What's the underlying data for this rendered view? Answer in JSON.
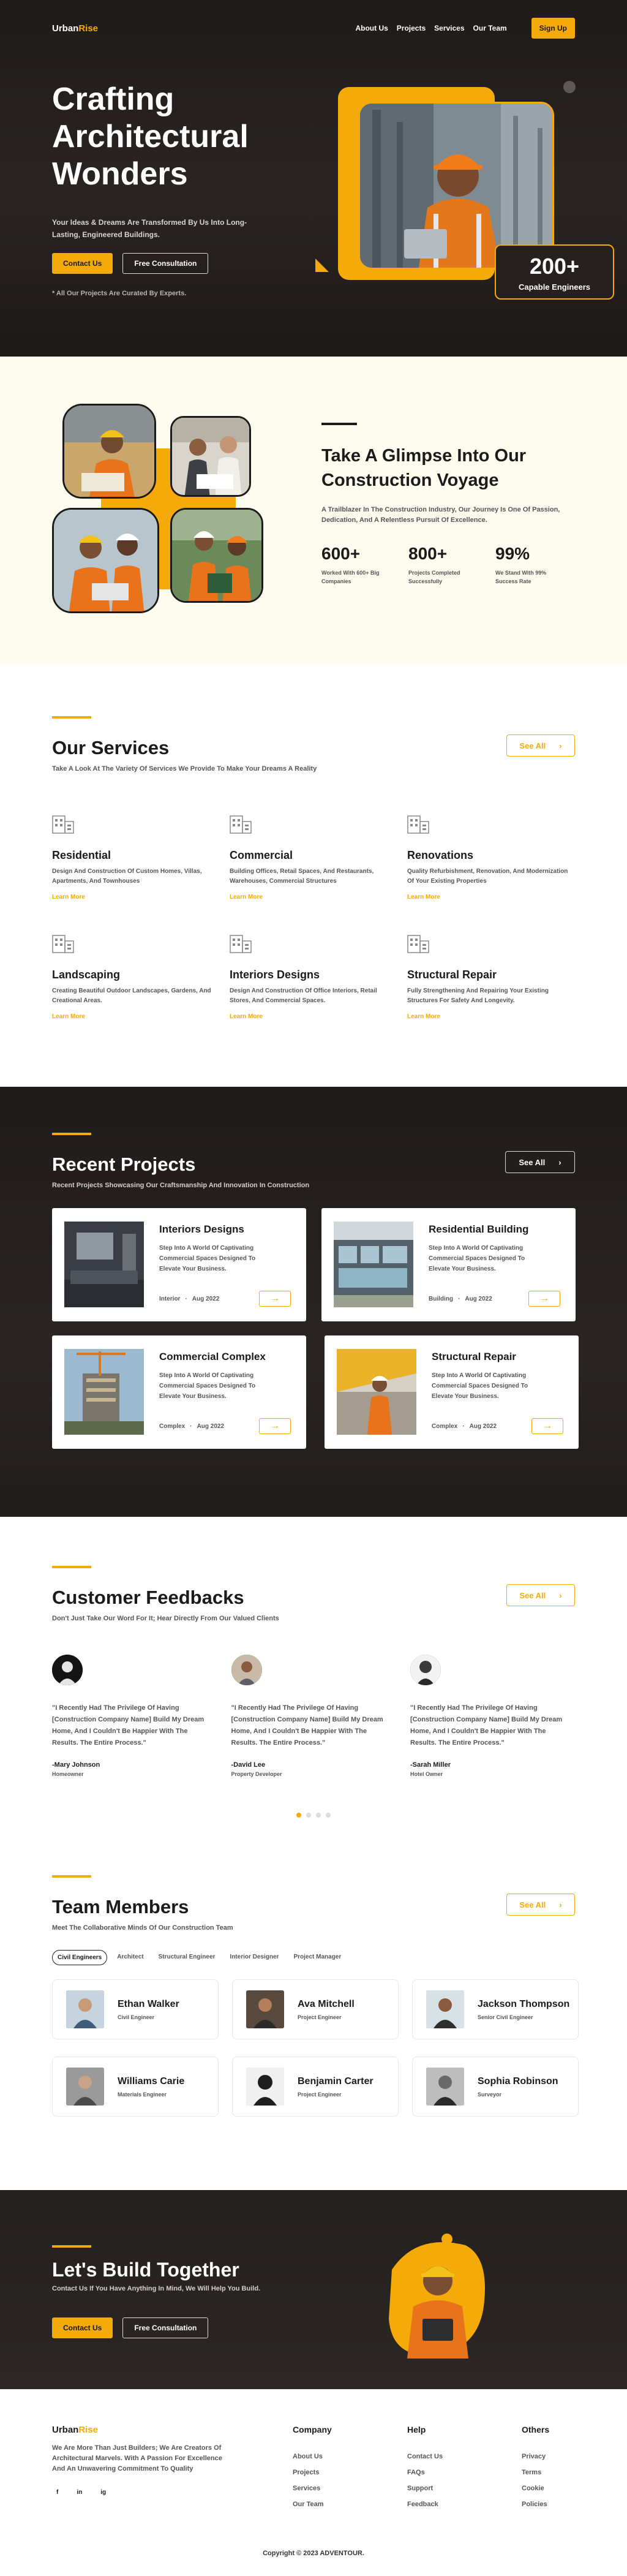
{
  "nav": {
    "brand_main": "Urban",
    "brand_accent": "Rise",
    "links": [
      "About Us",
      "Projects",
      "Services",
      "Our Team"
    ],
    "signup": "Sign Up"
  },
  "hero": {
    "title": "Crafting Architectural Wonders",
    "subtitle": "Your Ideas & Dreams Are Transformed By Us Into Long-Lasting, Engineered Buildings.",
    "contact_btn": "Contact Us",
    "consult_btn": "Free Consultation",
    "note": "* All Our Projects Are Curated By Experts.",
    "stat_value": "200+",
    "stat_label": "Capable Engineers"
  },
  "voyage": {
    "title": "Take A Glimpse Into Our Construction Voyage",
    "text": "A Trailblazer In The Construction Industry, Our Journey Is One Of Passion, Dedication, And A Relentless Pursuit Of Excellence.",
    "stats": [
      {
        "value": "600+",
        "label": "Worked With 600+ Big Companies"
      },
      {
        "value": "800+",
        "label": "Projects Completed Successfully"
      },
      {
        "value": "99%",
        "label": "We Stand With 99% Success Rate"
      }
    ]
  },
  "services": {
    "title": "Our Services",
    "subtitle": "Take A Look At The Variety Of Services We Provide To Make Your Dreams A Reality",
    "see_all": "See All",
    "learn_more": "Learn More",
    "items": [
      {
        "title": "Residential",
        "text": "Design And Construction Of Custom Homes, Villas, Apartments, And Townhouses"
      },
      {
        "title": "Commercial",
        "text": "Building Offices, Retail Spaces, And Restaurants, Warehouses, Commercial Structures"
      },
      {
        "title": "Renovations",
        "text": "Quality Refurbishment, Renovation, And Modernization Of Your  Existing Properties"
      },
      {
        "title": "Landscaping",
        "text": "Creating Beautiful Outdoor Landscapes, Gardens, And Creational Areas."
      },
      {
        "title": "Interiors Designs",
        "text": "Design And Construction Of Office Interiors, Retail Stores, And Commercial Spaces."
      },
      {
        "title": "Structural Repair",
        "text": "Fully Strengthening And Repairing Your Existing Structures For Safety And Longevity."
      }
    ]
  },
  "projects": {
    "title": "Recent Projects",
    "subtitle": "Recent Projects Showcasing Our Craftsmanship And Innovation In Construction",
    "see_all": "See All",
    "items": [
      {
        "title": "Interiors Designs",
        "text": "Step Into A World Of Captivating Commercial Spaces Designed To Elevate Your Business.",
        "category": "Interior",
        "date": "Aug 2022"
      },
      {
        "title": "Residential Building",
        "text": "Step Into A World Of Captivating Commercial Spaces Designed To Elevate Your Business.",
        "category": "Building",
        "date": "Aug 2022"
      },
      {
        "title": "Commercial Complex",
        "text": "Step Into A World Of Captivating Commercial Spaces Designed To Elevate Your Business.",
        "category": "Complex",
        "date": "Aug 2022"
      },
      {
        "title": "Structural Repair",
        "text": "Step Into A World Of Captivating Commercial Spaces Designed To Elevate Your Business.",
        "category": "Complex",
        "date": "Aug 2022"
      }
    ]
  },
  "feedback": {
    "title": "Customer Feedbacks",
    "subtitle": "Don't Just Take Our Word For It; Hear Directly From Our Valued Clients",
    "see_all": "See All",
    "items": [
      {
        "quote": "\"I Recently Had The Privilege Of Having [Construction Company Name] Build My Dream Home, And I Couldn't Be Happier With The Results. The Entire Process.\"",
        "name": "-Mary Johnson",
        "role": "Homeowner"
      },
      {
        "quote": "\"I Recently Had The Privilege Of Having [Construction Company Name] Build My Dream Home, And I Couldn't Be Happier With The Results. The Entire Process.\"",
        "name": "-David Lee",
        "role": "Property Developer"
      },
      {
        "quote": "\"I Recently Had The Privilege Of Having [Construction Company Name] Build My Dream Home, And I Couldn't Be Happier With The Results. The Entire Process.\"",
        "name": "-Sarah Miller",
        "role": "Hotel Owner"
      }
    ]
  },
  "team": {
    "title": "Team Members",
    "subtitle": "Meet The Collaborative Minds Of Our Construction Team",
    "see_all": "See All",
    "filters": [
      "Civil Engineers",
      "Architect",
      "Structural Engineer",
      "Interior Designer",
      "Project Manager"
    ],
    "members": [
      {
        "name": "Ethan Walker",
        "role": "Civil Engineer"
      },
      {
        "name": "Ava Mitchell",
        "role": "Project Engineer"
      },
      {
        "name": "Jackson Thompson",
        "role": "Senior Civil Engineer"
      },
      {
        "name": "Williams Carie",
        "role": "Materials Engineer"
      },
      {
        "name": "Benjamin Carter",
        "role": "Project Engineer"
      },
      {
        "name": "Sophia Robinson",
        "role": "Surveyor"
      }
    ]
  },
  "cta": {
    "title": "Let's Build Together",
    "subtitle": "Contact Us If You Have Anything In Mind, We Will Help You Build.",
    "contact_btn": "Contact Us",
    "consult_btn": "Free Consultation"
  },
  "footer": {
    "brand_main": "Urban",
    "brand_accent": "Rise",
    "text": "We Are More Than Just Builders; We Are Creators Of Architectural Marvels. With A Passion For Excellence And An Unwavering Commitment To Quality",
    "socials": [
      "f",
      "in",
      "ig"
    ],
    "columns": [
      {
        "title": "Company",
        "links": [
          "About Us",
          "Projects",
          "Services",
          "Our Team"
        ]
      },
      {
        "title": "Help",
        "links": [
          "Contact Us",
          "FAQs",
          "Support",
          "Feedback"
        ]
      },
      {
        "title": "Others",
        "links": [
          "Privacy",
          "Terms",
          "Cookie",
          "Policies"
        ]
      }
    ],
    "copyright": "Copyright © 2023 ADVENTOUR."
  },
  "colors": {
    "accent": "#f4ab0a",
    "dark": "#231f1d",
    "cream": "#fefbef"
  },
  "icons": [
    "building-icon",
    "arrow-right-icon",
    "facebook-icon",
    "linkedin-icon",
    "instagram-icon"
  ]
}
